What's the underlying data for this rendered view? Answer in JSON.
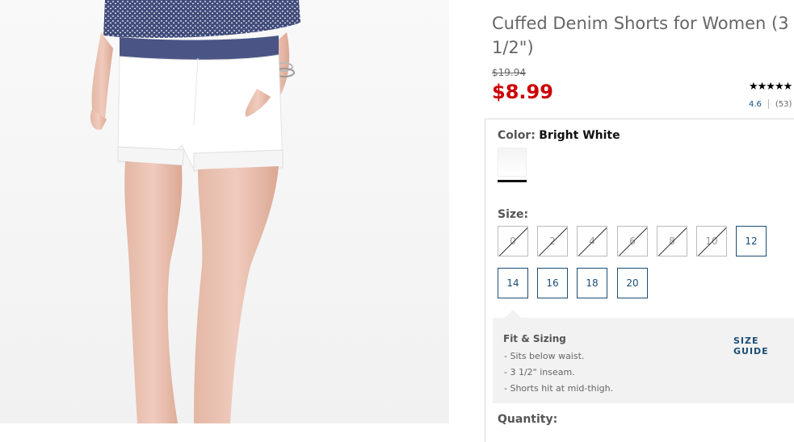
{
  "product": {
    "title": "Cuffed Denim Shorts for Women (3 1/2\")",
    "original_price": "$19.94",
    "sale_price": "$8.99",
    "rating_stars": "★★★★★",
    "rating": "4.6",
    "review_count": "(53)"
  },
  "color": {
    "label": "Color:",
    "selected": "Bright White"
  },
  "size": {
    "label": "Size:",
    "options": [
      {
        "label": "0",
        "available": false
      },
      {
        "label": "2",
        "available": false
      },
      {
        "label": "4",
        "available": false
      },
      {
        "label": "6",
        "available": false
      },
      {
        "label": "8",
        "available": false
      },
      {
        "label": "10",
        "available": false
      },
      {
        "label": "12",
        "available": true
      },
      {
        "label": "14",
        "available": true
      },
      {
        "label": "16",
        "available": true
      },
      {
        "label": "18",
        "available": true
      },
      {
        "label": "20",
        "available": true
      }
    ]
  },
  "fit": {
    "title": "Fit & Sizing",
    "size_guide_label": "SIZE GUIDE",
    "items": [
      "- Sits below waist.",
      "- 3 1/2\" inseam.",
      "- Shorts hit at mid-thigh."
    ]
  },
  "quantity": {
    "label": "Quantity:"
  },
  "colors": {
    "sale_red": "#cc0000",
    "link_blue": "#1a4d75"
  }
}
